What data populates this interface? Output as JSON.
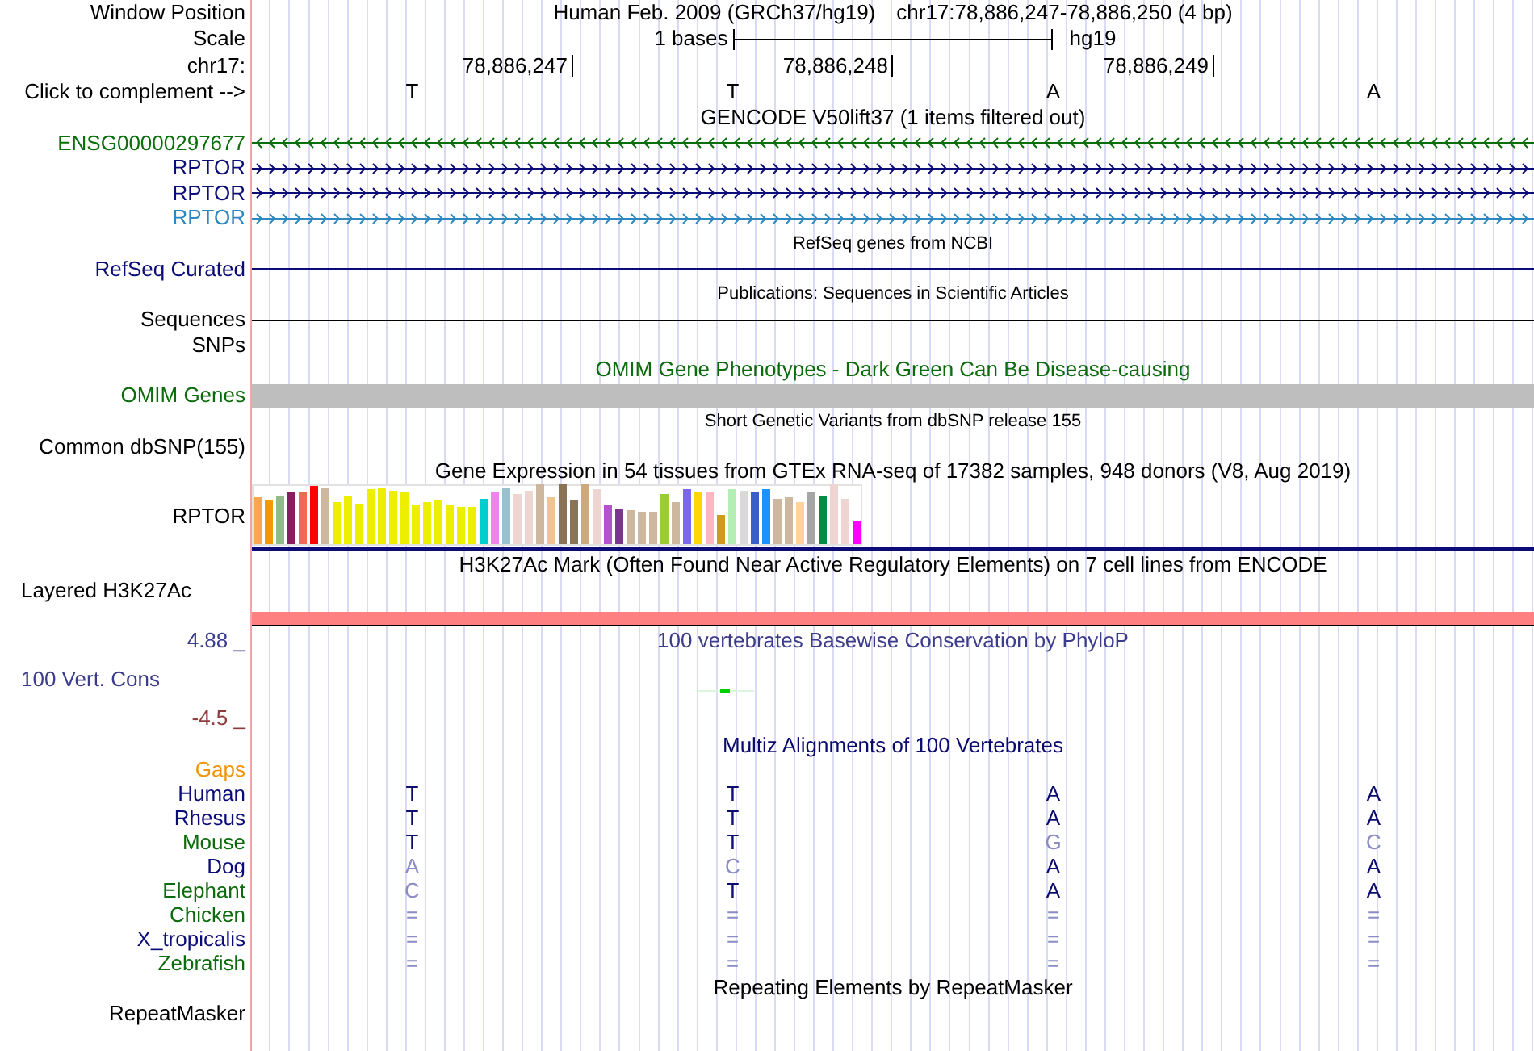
{
  "header": {
    "position_label": "Window Position",
    "assembly": "Human Feb. 2009 (GRCh37/hg19)",
    "position": "chr17:78,886,247-78,886,250 (4 bp)",
    "scale_label": "Scale",
    "scale_text": "1 bases",
    "scale_db": "hg19",
    "chrom_label": "chr17:",
    "ticks": [
      "78,886,247",
      "78,886,248",
      "78,886,249"
    ],
    "complement_label": "Click to complement -->",
    "bases": [
      "T",
      "T",
      "A",
      "A"
    ]
  },
  "tracks": [
    {
      "kind": "genes",
      "title": "GENCODE V50lift37 (1 items filtered out)",
      "small_title": false,
      "color": "#000000",
      "items": [
        {
          "name": "ENSG00000297677",
          "reverse": true,
          "color": "#0a6e0a"
        },
        {
          "name": "RPTOR",
          "reverse": false,
          "color": "#0c0c78"
        },
        {
          "name": "RPTOR",
          "reverse": false,
          "color": "#0c0c78"
        },
        {
          "name": "RPTOR",
          "reverse": false,
          "color": "#2d88c0"
        }
      ]
    },
    {
      "kind": "lines",
      "title": "RefSeq genes from NCBI",
      "small_title": true,
      "color": "#0c0c78",
      "rows": [
        {
          "label": "RefSeq Curated",
          "feature": true
        }
      ]
    },
    {
      "kind": "lines",
      "title": "Publications: Sequences in Scientific Articles",
      "small_title": true,
      "color": "#000000",
      "rows": [
        {
          "label": "Sequences",
          "feature": true
        },
        {
          "label": "SNPs",
          "feature": false
        }
      ]
    },
    {
      "kind": "bar",
      "title": "OMIM Gene Phenotypes - Dark Green Can Be Disease-causing",
      "small_title": false,
      "color": "#0c6b0c",
      "label": "OMIM Genes",
      "bar": {
        "color": "#bebebe"
      }
    },
    {
      "kind": "lines",
      "title": "Short Genetic Variants from dbSNP release 155",
      "small_title": true,
      "color": "#000000",
      "rows": [
        {
          "label": "Common dbSNP(155)",
          "feature": false
        }
      ]
    },
    {
      "kind": "expression",
      "title": "Gene Expression in 54 tissues from GTEx RNA-seq of 17382 samples, 948 donors (V8, Aug 2019)",
      "small_title": false,
      "color": "#000000",
      "label": "RPTOR"
    },
    {
      "kind": "layered",
      "title": "H3K27Ac Mark (Often Found Near Active Regulatory Elements) on 7 cell lines from ENCODE",
      "small_title": false,
      "color": "#000000",
      "label": "Layered H3K27Ac",
      "bar": {
        "color": "#ff8080"
      }
    },
    {
      "kind": "wiggle",
      "title": "100 vertebrates Basewise Conservation by PhyloP",
      "small_title": false,
      "color": "#3c3c8c",
      "max": "4.88 _",
      "label": "100 Vert. Cons",
      "min": {
        "label": "-4.5 _",
        "color": "#8c3c3c"
      }
    },
    {
      "kind": "multiz",
      "title": "Multiz Alignments of 100 Vertebrates",
      "small_title": false,
      "color": "#0a0a6e",
      "gaps": {
        "label": "Gaps",
        "color": "#f0940a"
      },
      "species": [
        {
          "name": "Human",
          "color": "#0c0c78",
          "bases": [
            {
              "base": "T",
              "match": true
            },
            {
              "base": "T",
              "match": true
            },
            {
              "base": "A",
              "match": true
            },
            {
              "base": "A",
              "match": true
            }
          ]
        },
        {
          "name": "Rhesus",
          "color": "#0c0c78",
          "bases": [
            {
              "base": "T",
              "match": true
            },
            {
              "base": "T",
              "match": true
            },
            {
              "base": "A",
              "match": true
            },
            {
              "base": "A",
              "match": true
            }
          ]
        },
        {
          "name": "Mouse",
          "color": "#0c6b0c",
          "bases": [
            {
              "base": "T",
              "match": true
            },
            {
              "base": "T",
              "match": true
            },
            {
              "base": "G",
              "match": false
            },
            {
              "base": "C",
              "match": false
            }
          ]
        },
        {
          "name": "Dog",
          "color": "#0c0c78",
          "bases": [
            {
              "base": "A",
              "match": false
            },
            {
              "base": "C",
              "match": false
            },
            {
              "base": "A",
              "match": true
            },
            {
              "base": "A",
              "match": true
            }
          ]
        },
        {
          "name": "Elephant",
          "color": "#0c6b0c",
          "bases": [
            {
              "base": "C",
              "match": false
            },
            {
              "base": "T",
              "match": true
            },
            {
              "base": "A",
              "match": true
            },
            {
              "base": "A",
              "match": true
            }
          ]
        },
        {
          "name": "Chicken",
          "color": "#0c6b0c",
          "bases": [
            {
              "base": "=",
              "match": false
            },
            {
              "base": "=",
              "match": false
            },
            {
              "base": "=",
              "match": false
            },
            {
              "base": "=",
              "match": false
            }
          ]
        },
        {
          "name": "X_tropicalis",
          "color": "#0c0c78",
          "bases": [
            {
              "base": "=",
              "match": false
            },
            {
              "base": "=",
              "match": false
            },
            {
              "base": "=",
              "match": false
            },
            {
              "base": "=",
              "match": false
            }
          ]
        },
        {
          "name": "Zebrafish",
          "color": "#0c6b0c",
          "bases": [
            {
              "base": "=",
              "match": false
            },
            {
              "base": "=",
              "match": false
            },
            {
              "base": "=",
              "match": false
            },
            {
              "base": "=",
              "match": false
            }
          ]
        }
      ]
    },
    {
      "kind": "lines",
      "title": "Repeating Elements by RepeatMasker",
      "small_title": false,
      "color": "#000000",
      "rows": [
        {
          "label": "RepeatMasker",
          "feature": false
        }
      ]
    }
  ]
}
